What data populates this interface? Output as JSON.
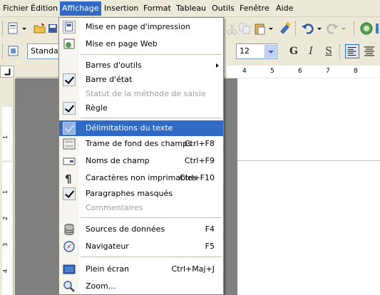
{
  "menubar": {
    "items": [
      "Fichier",
      "Édition",
      "Affichage",
      "Insertion",
      "Format",
      "Tableau",
      "Outils",
      "Fenêtre",
      "Aide"
    ],
    "active_index": 2
  },
  "toolbar": {
    "style_combo": "Standard",
    "size_combo": "12",
    "bold": "G",
    "italic": "I",
    "underline": "S"
  },
  "ruler": {
    "h_ticks": [
      "4",
      "5",
      "6",
      "7",
      "8"
    ],
    "v_ticks": [
      "1",
      "1",
      "2",
      "3",
      "4"
    ]
  },
  "menu": {
    "items": [
      {
        "label": "Mise en page d'impression",
        "icon": "print-layout-icon",
        "state": "toggled"
      },
      {
        "label": "Mise en page Web",
        "icon": "web-layout-icon"
      },
      {
        "label": "Barres d'outils",
        "submenu": true
      },
      {
        "label": "Barre d'état",
        "checked": true
      },
      {
        "label": "Statut de la méthode de saisie",
        "disabled": true
      },
      {
        "label": "Règle",
        "checked": true
      },
      {
        "label": "Délimitations du texte",
        "checked": true,
        "highlighted": true
      },
      {
        "label": "Trame de fond des champs",
        "shortcut": "Ctrl+F8",
        "icon": "field-shading-icon"
      },
      {
        "label": "Noms de champ",
        "shortcut": "Ctrl+F9",
        "icon": "field-names-icon"
      },
      {
        "label": "Caractères non imprimables",
        "shortcut": "Ctrl+F10",
        "icon": "pilcrow-icon"
      },
      {
        "label": "Paragraphes masqués",
        "checked": true
      },
      {
        "label": "Commentaires",
        "disabled": true
      },
      {
        "label": "Sources de données",
        "shortcut": "F4",
        "icon": "database-icon"
      },
      {
        "label": "Navigateur",
        "shortcut": "F5",
        "icon": "navigator-icon"
      },
      {
        "label": "Plein écran",
        "shortcut": "Ctrl+Maj+J",
        "icon": "fullscreen-icon"
      },
      {
        "label": "Zoom...",
        "icon": "zoom-icon"
      }
    ]
  },
  "colors": {
    "highlight": "#316ac5",
    "menu_bg": "#ffffff",
    "chrome_bg": "#ece9d8"
  }
}
